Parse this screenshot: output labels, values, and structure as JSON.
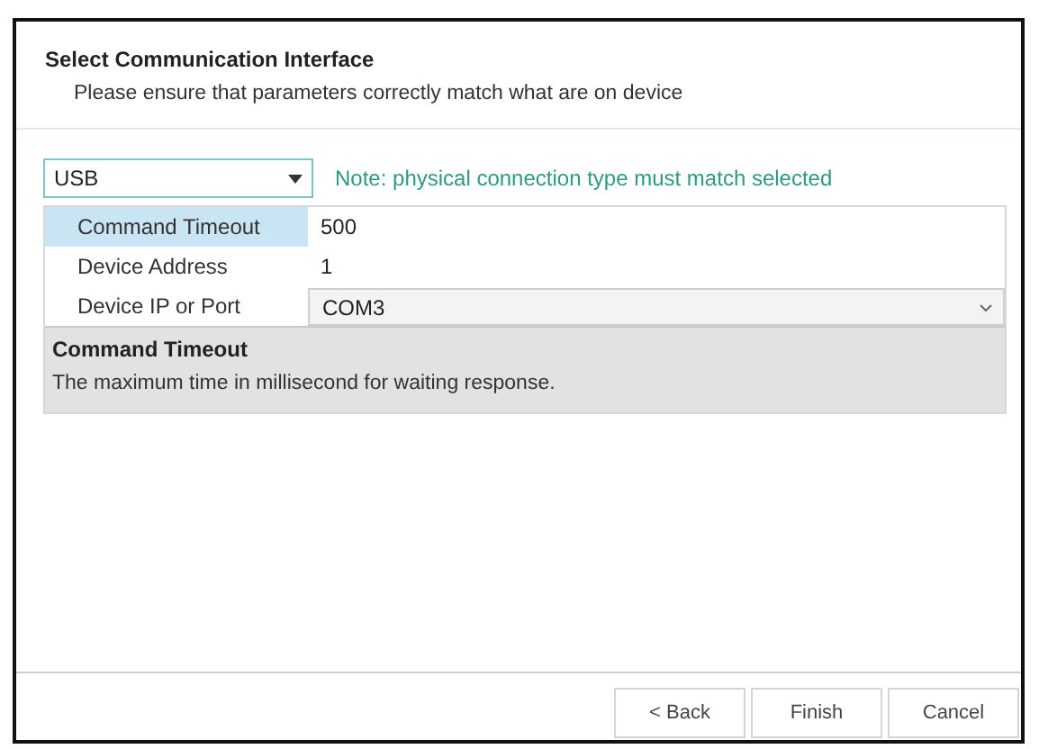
{
  "header": {
    "title": "Select Communication Interface",
    "subtitle": "Please ensure that parameters correctly match what are on device"
  },
  "interface": {
    "value": "USB",
    "note": "Note: physical connection type must match selected"
  },
  "properties": [
    {
      "label": "Command Timeout",
      "value": "500",
      "kind": "text",
      "selected": true
    },
    {
      "label": "Device Address",
      "value": "1",
      "kind": "text",
      "selected": false
    },
    {
      "label": "Device IP or Port",
      "value": "COM3",
      "kind": "dropdown",
      "selected": false
    }
  ],
  "description": {
    "title": "Command Timeout",
    "text": "The maximum time in millisecond for waiting response."
  },
  "buttons": [
    "< Back",
    "Finish",
    "Cancel"
  ]
}
